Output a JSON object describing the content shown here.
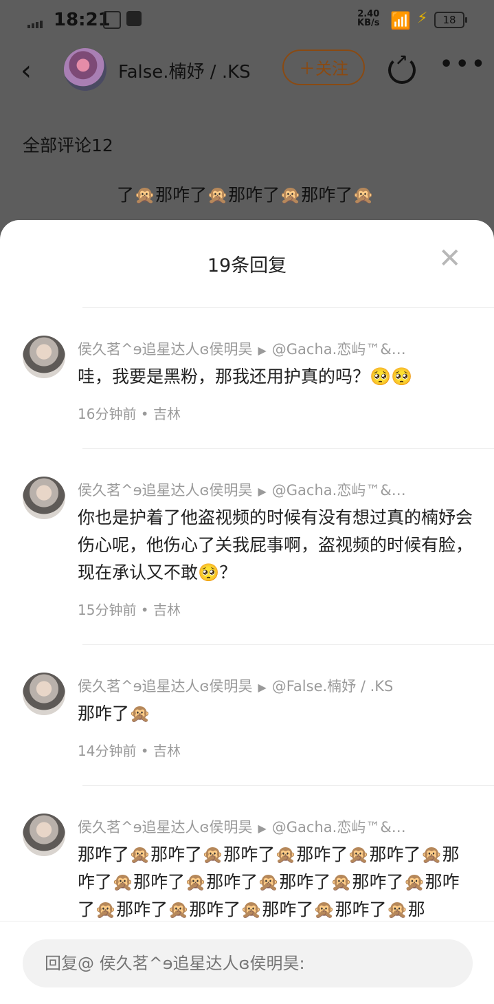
{
  "status_bar": {
    "time": "18:21",
    "net_speed_value": "2.40",
    "net_speed_unit": "KB/s",
    "battery": "18"
  },
  "header": {
    "back_icon": "back-arrow-icon",
    "author": "False.楠妤 / .KS",
    "follow_label": "关注",
    "share_icon": "share-icon",
    "more_icon": "more-icon"
  },
  "comments_heading": "全部评论12",
  "background_preview": "了🙊那咋了🙊那咋了🙊那咋了🙊",
  "sheet": {
    "title": "19条回复",
    "close_icon": "close-icon"
  },
  "replies": [
    {
      "user": "侯久茗^ɘ追星达人ɞ侯明昊",
      "to": "@Gacha.恋屿™&…",
      "text": "哇，我要是黑粉，那我还用护真的吗？🥺🥺",
      "time": "16分钟前 • 吉林"
    },
    {
      "user": "侯久茗^ɘ追星达人ɞ侯明昊",
      "to": "@Gacha.恋屿™&…",
      "text": "你也是护着了他盗视频的时候有没有想过真的楠妤会伤心呢，他伤心了关我屁事啊，盗视频的时候有脸，现在承认又不敢🥺？",
      "time": "15分钟前 • 吉林"
    },
    {
      "user": "侯久茗^ɘ追星达人ɞ侯明昊",
      "to": "@False.楠妤 / .KS",
      "text": "那咋了🙊",
      "time": "14分钟前 • 吉林"
    },
    {
      "user": "侯久茗^ɘ追星达人ɞ侯明昊",
      "to": "@Gacha.恋屿™&…",
      "text": "那咋了🙊那咋了🙊那咋了🙊那咋了🙊那咋了🙊那咋了🙊那咋了🙊那咋了🙊那咋了🙊那咋了🙊那咋了🙊那咋了🙊那咋了🙊那咋了🙊那咋了🙊那",
      "time": ""
    }
  ],
  "input": {
    "placeholder": "回复@ 侯久茗^ɘ追星达人ɞ侯明昊:"
  }
}
